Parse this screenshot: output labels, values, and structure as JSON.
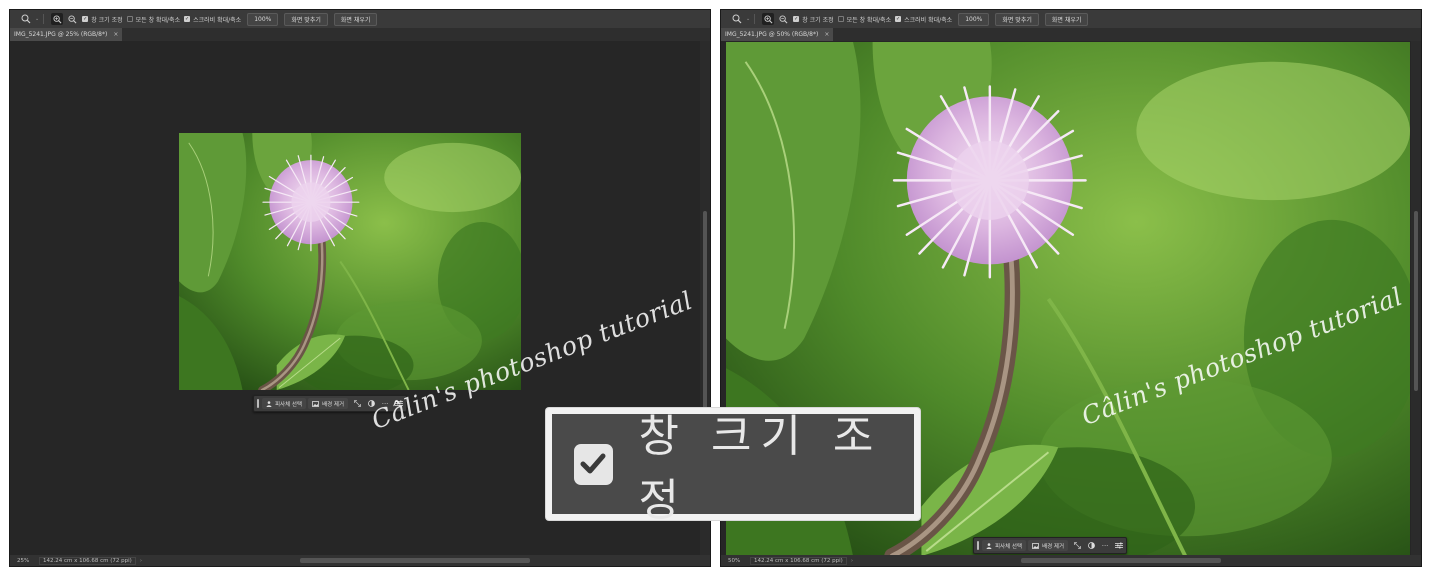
{
  "colors": {
    "app_bg": "#262626",
    "optbar_bg": "#3a3a3a",
    "accent_text": "#cfcfcf"
  },
  "left": {
    "options": {
      "resize_windows": "창 크기 조정",
      "zoom_all_windows": "모든 창 확대/축소",
      "scrubby_zoom": "스크러비 확대/축소",
      "zoom_value": "100%",
      "fit_screen": "화면 맞추기",
      "fill_screen": "화면 채우기"
    },
    "tab_title": "IMG_5241.JPG @ 25% (RGB/8*)",
    "tab_close": "×",
    "status_zoom": "25%",
    "status_docinfo": "142.24 cm x 106.68 cm (72 ppi)",
    "context_bar": {
      "select_subject": "피사체 선택",
      "remove_background": "배경 제거",
      "more": "···"
    }
  },
  "right": {
    "options": {
      "resize_windows": "창 크기 조정",
      "zoom_all_windows": "모든 창 확대/축소",
      "scrubby_zoom": "스크러비 확대/축소",
      "zoom_value": "100%",
      "fit_screen": "화면 맞추기",
      "fill_screen": "화면 채우기"
    },
    "tab_title": "IMG_5241.JPG @ 50% (RGB/8*)",
    "tab_close": "×",
    "status_zoom": "50%",
    "status_docinfo": "142.24 cm x 106.68 cm (72 ppi)",
    "context_bar": {
      "select_subject": "피사체 선택",
      "remove_background": "배경 제거",
      "more": "···"
    }
  },
  "watermark": "Câlin's photoshop tutorial",
  "callout": {
    "label": "창 크기 조정",
    "checked": true
  },
  "icons": {
    "zoom_tool": "magnifier-icon",
    "zoom_in": "zoom-in-icon",
    "zoom_out": "zoom-out-icon",
    "checkbox": "check-icon",
    "context": [
      "person-icon",
      "image-icon",
      "expand-icon",
      "contrast-icon",
      "more-icon",
      "sliders-icon"
    ]
  }
}
